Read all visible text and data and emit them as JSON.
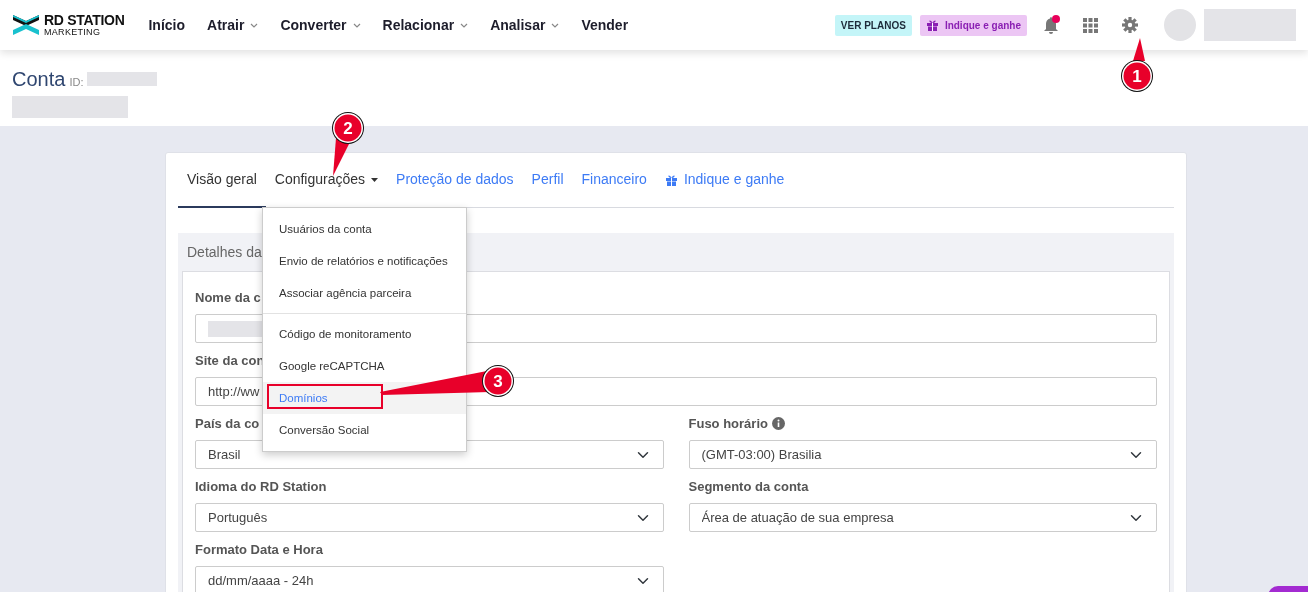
{
  "navbar": {
    "logo": {
      "line1": "RD STATION",
      "line2": "MARKETING"
    },
    "menu": [
      {
        "label": "Início",
        "dropdown": false
      },
      {
        "label": "Atrair",
        "dropdown": true
      },
      {
        "label": "Converter",
        "dropdown": true
      },
      {
        "label": "Relacionar",
        "dropdown": true
      },
      {
        "label": "Analisar",
        "dropdown": true
      },
      {
        "label": "Vender",
        "dropdown": false
      }
    ],
    "plans_button": "VER PLANOS",
    "refer_button": "Indique e ganhe",
    "notification_dot": true
  },
  "page": {
    "title": "Conta",
    "id_label": "ID:"
  },
  "tabs": [
    {
      "label": "Visão geral",
      "selected": true,
      "kind": "link"
    },
    {
      "label": "Configurações",
      "selected": false,
      "kind": "dropdown"
    },
    {
      "label": "Proteção de dados",
      "selected": false,
      "kind": "link"
    },
    {
      "label": "Perfil",
      "selected": false,
      "kind": "link"
    },
    {
      "label": "Financeiro",
      "selected": false,
      "kind": "link"
    },
    {
      "label": "Indique e ganhe",
      "selected": false,
      "kind": "gift"
    }
  ],
  "dropdown_menu": {
    "groups": [
      [
        {
          "label": "Usuários da conta",
          "selected": false
        },
        {
          "label": "Envio de relatórios e notificações",
          "selected": false
        },
        {
          "label": "Associar agência parceira",
          "selected": false
        }
      ],
      [
        {
          "label": "Código de monitoramento",
          "selected": false
        },
        {
          "label": "Google reCAPTCHA",
          "selected": false
        },
        {
          "label": "Domínios",
          "selected": true
        },
        {
          "label": "Conversão Social",
          "selected": false
        }
      ]
    ]
  },
  "section": {
    "title": "Detalhes da",
    "rows": [
      [
        {
          "label": "Nome da c",
          "kind": "text",
          "info": false,
          "redacted": true
        }
      ],
      [
        {
          "label": "Site da con",
          "kind": "text",
          "info": false,
          "redacted": false,
          "value": "http://ww"
        }
      ],
      [
        {
          "label": "País da co",
          "kind": "select",
          "info": false,
          "value": "Brasil"
        },
        {
          "label": "Fuso horário",
          "kind": "select",
          "info": true,
          "value": "(GMT-03:00) Brasilia"
        }
      ],
      [
        {
          "label": "Idioma do RD Station",
          "kind": "select",
          "info": false,
          "value": "Português"
        },
        {
          "label": "Segmento da conta",
          "kind": "select",
          "info": false,
          "value": "Área de atuação de sua empresa"
        }
      ],
      [
        {
          "label": "Formato Data e Hora",
          "kind": "select",
          "info": false,
          "value": "dd/mm/aaaa - 24h"
        }
      ]
    ]
  },
  "annotations": [
    {
      "number": "1"
    },
    {
      "number": "2"
    },
    {
      "number": "3"
    }
  ]
}
